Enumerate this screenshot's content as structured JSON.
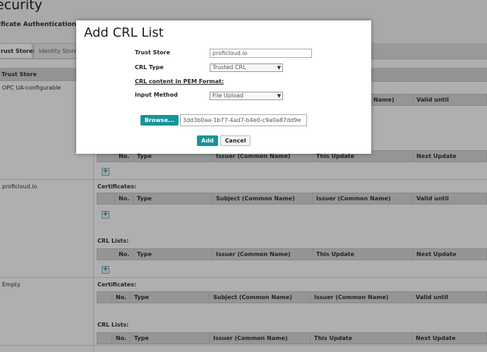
{
  "page": {
    "title": "ecurity",
    "subtitle": "ificate Authentication"
  },
  "tabs": [
    {
      "label": "rust Stores",
      "active": true
    },
    {
      "label": "Identity Store",
      "active": false
    }
  ],
  "left_column": {
    "header": "Trust Store",
    "stores": [
      "OPC UA-configurable",
      "proficloud.io",
      "Empty"
    ]
  },
  "sections": {
    "certificates_label": "Certificates:",
    "crl_lists_label": "CRL Lists:",
    "add_symbol": "+"
  },
  "cert_columns": [
    "No.",
    "Type",
    "Subject (Common Name)",
    "Issuer (Common Name)",
    "Valid until"
  ],
  "crl_columns": [
    "No.",
    "Type",
    "Issuer (Common Name)",
    "This Update",
    "Next Update"
  ],
  "behind_dialog_columns": {
    "issuer_fragment": "Name)",
    "valid_until": "Valid until"
  },
  "dialog": {
    "title": "Add CRL List",
    "trust_store_label": "Trust Store",
    "trust_store_value": "proficloud.io",
    "crl_type_label": "CRL Type",
    "crl_type_value": "Trusted CRL",
    "pem_label": "CRL content in PEM Format:",
    "input_method_label": "Input Method",
    "input_method_value": "File Upload",
    "browse_label": "Browse...",
    "file_name": "3dd3b0aa-1b77-4ad7-b4e0-c9a0a87dd9e",
    "add_label": "Add",
    "cancel_label": "Cancel"
  },
  "colors": {
    "accent": "#18939b",
    "table_header": "#d6d6d6"
  },
  "icons": {
    "dropdown": "chevron-down-icon",
    "add": "plus-icon"
  }
}
